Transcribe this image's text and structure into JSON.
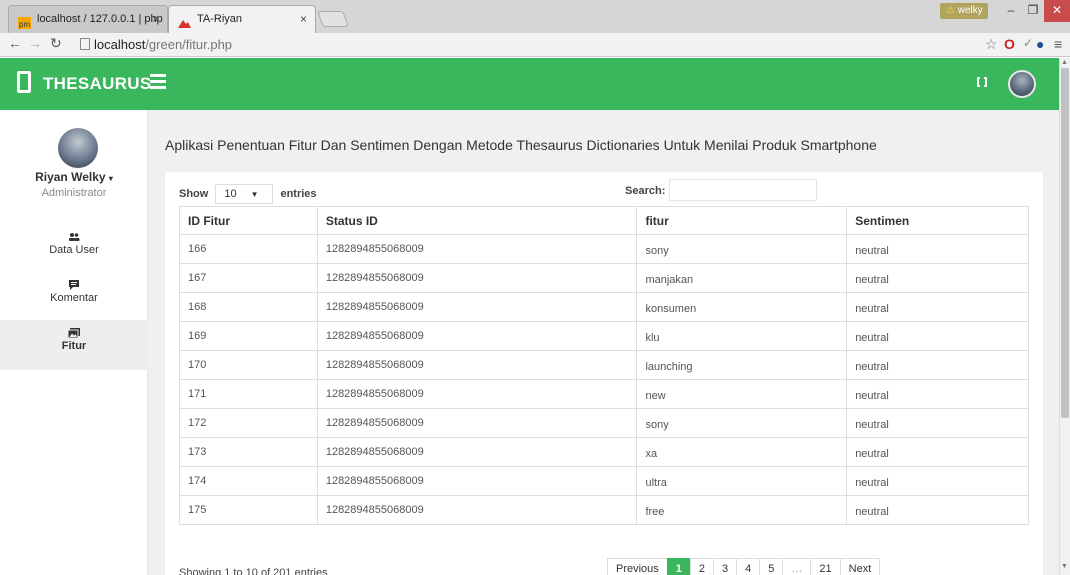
{
  "browser": {
    "tabs": [
      {
        "title": "localhost / 127.0.0.1 | php"
      },
      {
        "title": "TA-Riyan"
      }
    ],
    "url_host": "localhost",
    "url_path": "/green/fitur.php",
    "user_badge": "welky"
  },
  "header": {
    "brand": "THESAURUS"
  },
  "sidebar": {
    "user_name": "Riyan Welky",
    "user_role": "Administrator",
    "items": [
      {
        "label": "Data User",
        "icon": "users-icon"
      },
      {
        "label": "Komentar",
        "icon": "comment-icon"
      },
      {
        "label": "Fitur",
        "icon": "images-icon"
      }
    ],
    "active": "Fitur"
  },
  "main": {
    "title": "Aplikasi Penentuan Fitur Dan Sentimen Dengan Metode Thesaurus Dictionaries Untuk Menilai Produk Smartphone",
    "length_show": "Show",
    "length_value": "10",
    "length_entries": "entries",
    "search_label": "Search:",
    "search_value": "",
    "columns": [
      "ID Fitur",
      "Status ID",
      "fitur",
      "Sentimen"
    ],
    "rows": [
      [
        "166",
        "1282894855068009",
        "sony",
        "neutral"
      ],
      [
        "167",
        "1282894855068009",
        "manjakan",
        "neutral"
      ],
      [
        "168",
        "1282894855068009",
        "konsumen",
        "neutral"
      ],
      [
        "169",
        "1282894855068009",
        "klu",
        "neutral"
      ],
      [
        "170",
        "1282894855068009",
        "launching",
        "neutral"
      ],
      [
        "171",
        "1282894855068009",
        "new",
        "neutral"
      ],
      [
        "172",
        "1282894855068009",
        "sony",
        "neutral"
      ],
      [
        "173",
        "1282894855068009",
        "xa",
        "neutral"
      ],
      [
        "174",
        "1282894855068009",
        "ultra",
        "neutral"
      ],
      [
        "175",
        "1282894855068009",
        "free",
        "neutral"
      ]
    ],
    "info": "Showing 1 to 10 of 201 entries",
    "pagination": [
      "Previous",
      "1",
      "2",
      "3",
      "4",
      "5",
      "…",
      "21",
      "Next"
    ],
    "current_page": "1"
  },
  "colors": {
    "accent": "#3ab65c"
  }
}
